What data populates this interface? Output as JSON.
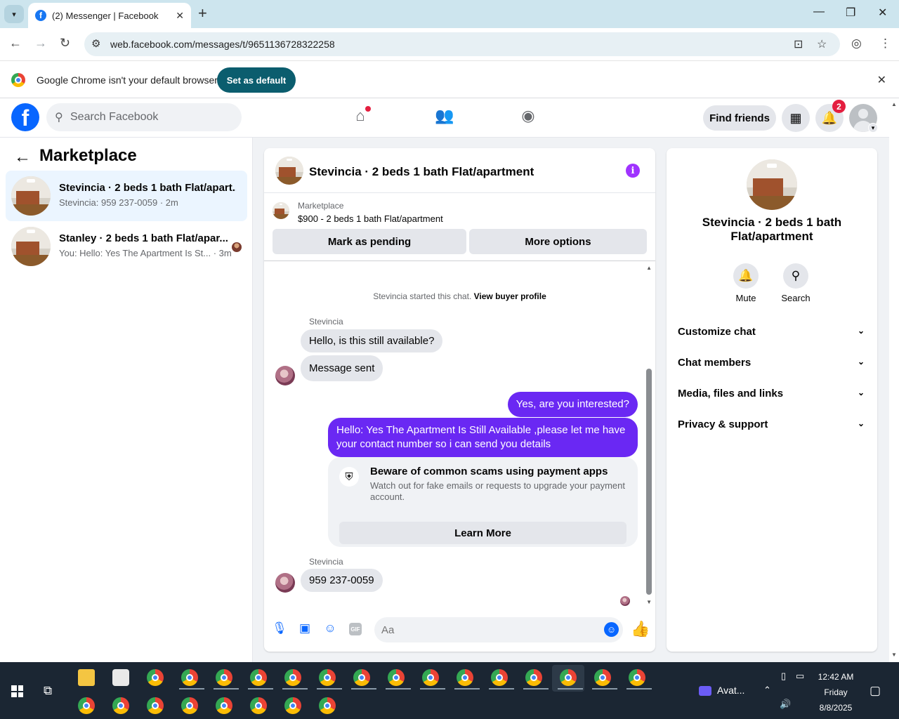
{
  "browser": {
    "tab_title": "(2) Messenger | Facebook",
    "url": "web.facebook.com/messages/t/9651136728322258",
    "infobar_text": "Google Chrome isn't your default browser",
    "infobar_button": "Set as default"
  },
  "fb": {
    "logo": "f",
    "search_placeholder": "Search Facebook",
    "find_friends": "Find friends",
    "notif_count": "2"
  },
  "sidebar": {
    "title": "Marketplace",
    "conversations": [
      {
        "name": "Stevincia · 2 beds 1 bath Flat/apart...",
        "preview": "Stevincia: 959 237-0059 · 2m"
      },
      {
        "name": "Stanley · 2 beds 1 bath Flat/apar...",
        "preview": "You: Hello: Yes The Apartment Is St... · 3m"
      }
    ]
  },
  "chat": {
    "title": "Stevincia · 2 beds 1 bath Flat/apartment",
    "listing_label": "Marketplace",
    "listing_price": "$900 - 2 beds 1 bath Flat/apartment",
    "btn_pending": "Mark as pending",
    "btn_more": "More options",
    "system_text": "Stevincia started this chat.",
    "system_link": "View buyer profile",
    "sender1": "Stevincia",
    "msg1": "Hello, is this still available?",
    "msg2": "Message sent",
    "out1": "Yes, are you interested?",
    "out2": "Hello: Yes The Apartment Is Still Available ,please let me have your contact number so i can send you details",
    "scam_title": "Beware of common scams using payment apps",
    "scam_text": "Watch out for fake emails or requests to upgrade your payment account.",
    "scam_button": "Learn More",
    "sender2": "Stevincia",
    "msg3": "959 237-0059",
    "composer_placeholder": "Aa"
  },
  "details": {
    "title": "Stevincia · 2 beds 1 bath Flat/apartment",
    "mute": "Mute",
    "search": "Search",
    "rows": [
      "Customize chat",
      "Chat members",
      "Media, files and links",
      "Privacy & support"
    ]
  },
  "taskbar": {
    "tray_app": "Avat...",
    "time": "12:42 AM",
    "day": "Friday",
    "date": "8/8/2025"
  },
  "colors": {
    "fb_blue": "#0866ff",
    "outgoing_bubble": "#6a28f3",
    "active_conv": "#ebf5ff"
  }
}
